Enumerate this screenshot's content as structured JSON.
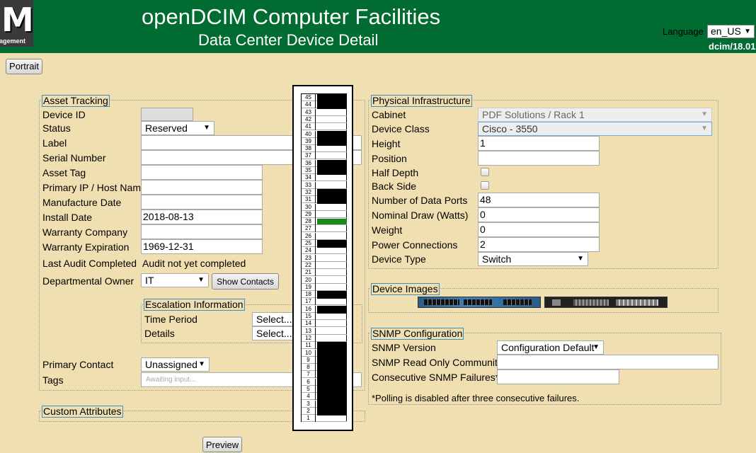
{
  "header": {
    "logo_letter": "M",
    "logo_text": "agement",
    "title": "openDCIM Computer Facilities",
    "subtitle": "Data Center Device Detail",
    "language_label": "Language",
    "language_value": "en_US",
    "version": "dcim/18.01",
    "bg_color": "#006c31"
  },
  "toolbar": {
    "portrait_label": "Portrait",
    "preview_label": "Preview"
  },
  "asset": {
    "legend": "Asset Tracking",
    "device_id_label": "Device ID",
    "status_label": "Status",
    "status_value": "Reserved",
    "label_label": "Label",
    "serial_label": "Serial Number",
    "asset_tag_label": "Asset Tag",
    "ip_label": "Primary IP / Host Name",
    "manufacture_label": "Manufacture Date",
    "install_label": "Install Date",
    "install_value": "2018-08-13",
    "warranty_company_label": "Warranty Company",
    "warranty_exp_label": "Warranty Expiration",
    "warranty_exp_value": "1969-12-31",
    "audit_label": "Last Audit Completed",
    "audit_value": "Audit not yet completed",
    "owner_label": "Departmental Owner",
    "owner_value": "IT",
    "show_contacts_label": "Show Contacts",
    "escalation_legend": "Escalation Information",
    "time_period_label": "Time Period",
    "time_period_value": "Select...",
    "details_label": "Details",
    "details_value": "Select...",
    "primary_contact_label": "Primary Contact",
    "primary_contact_value": "Unassigned",
    "tags_label": "Tags",
    "tags_placeholder": "Awaiting input..."
  },
  "custom": {
    "legend": "Custom Attributes"
  },
  "physical": {
    "legend": "Physical Infrastructure",
    "cabinet_label": "Cabinet",
    "cabinet_value": "PDF Solutions / Rack 1",
    "device_class_label": "Device Class",
    "device_class_value": "Cisco - 3550",
    "height_label": "Height",
    "height_value": "1",
    "position_label": "Position",
    "half_depth_label": "Half Depth",
    "back_side_label": "Back Side",
    "ports_label": "Number of Data Ports",
    "ports_value": "48",
    "draw_label": "Nominal Draw (Watts)",
    "draw_value": "0",
    "weight_label": "Weight",
    "weight_value": "0",
    "power_label": "Power Connections",
    "power_value": "2",
    "type_label": "Device Type",
    "type_value": "Switch"
  },
  "images": {
    "legend": "Device Images"
  },
  "snmp": {
    "legend": "SNMP Configuration",
    "version_label": "SNMP Version",
    "version_value": "Configuration Default",
    "community_label": "SNMP Read Only Community",
    "failures_label": "Consecutive SNMP Failures*",
    "note": "*Polling is disabled after three consecutive failures."
  },
  "rack": {
    "units": [
      "45",
      "44",
      "43",
      "42",
      "41",
      "40",
      "39",
      "38",
      "37",
      "36",
      "35",
      "34",
      "33",
      "32",
      "31",
      "30",
      "29",
      "28",
      "27",
      "26",
      "25",
      "24",
      "23",
      "22",
      "21",
      "20",
      "19",
      "18",
      "17",
      "16",
      "15",
      "14",
      "13",
      "12",
      "11",
      "10",
      "9",
      "8",
      "7",
      "6",
      "5",
      "4",
      "3",
      "2",
      "1"
    ],
    "occupied": [
      45,
      44,
      40,
      39,
      36,
      35,
      32,
      31,
      25,
      18,
      16,
      11,
      10,
      9,
      8,
      7,
      6,
      5,
      4,
      3,
      2
    ],
    "highlight": 28,
    "device_color": "#000000",
    "highlight_color": "#1a8a1a"
  }
}
